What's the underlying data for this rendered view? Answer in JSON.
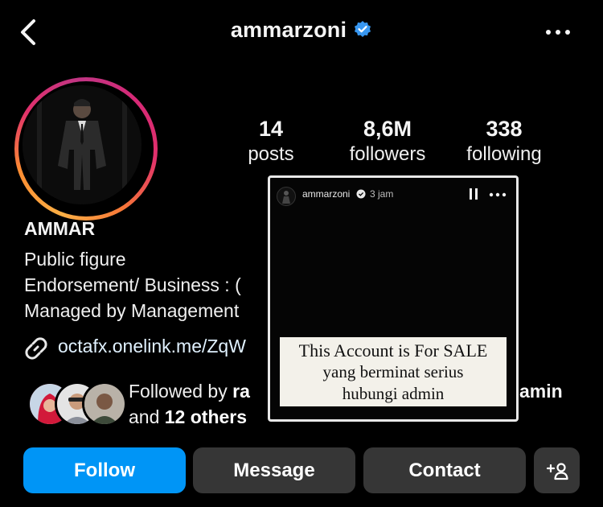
{
  "header": {
    "username": "ammarzoni",
    "back_icon": "chevron-left-icon",
    "verified_icon": "verified-badge-icon",
    "more_icon": "more-horizontal-icon",
    "verified_color": "#3897f0"
  },
  "stats": {
    "posts": {
      "value": "14",
      "label": "posts"
    },
    "followers": {
      "value": "8,6M",
      "label": "followers"
    },
    "following": {
      "value": "338",
      "label": "following"
    }
  },
  "bio": {
    "name": "AMMAR",
    "category": "Public figure",
    "line1": "Endorsement/ Business : (",
    "line2": "Managed by Management",
    "link": "octafx.onelink.me/ZqW"
  },
  "followed_by": {
    "prefix": "Followed by ",
    "name_fragment": "ra",
    "and": "and ",
    "others": "12 others",
    "tail": "amin"
  },
  "actions": {
    "follow": "Follow",
    "message": "Message",
    "contact": "Contact",
    "add_user_icon": "add-user-icon",
    "follow_color": "#0095f6"
  },
  "story": {
    "username": "ammarzoni",
    "time": "3 jam",
    "line1": "This Account is For SALE",
    "line2": "yang berminat serius",
    "line3": "hubungi admin"
  }
}
